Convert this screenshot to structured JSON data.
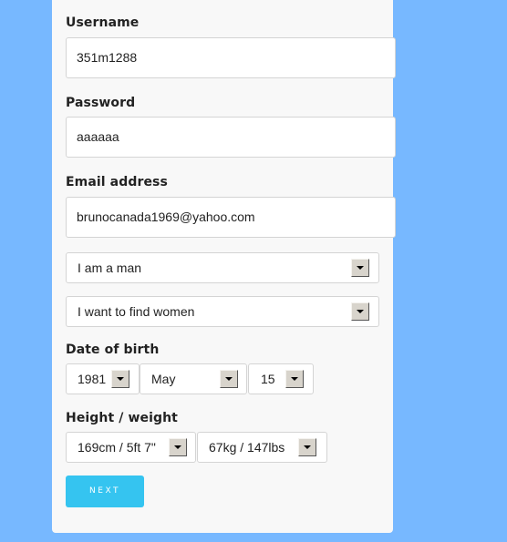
{
  "form": {
    "username": {
      "label": "Username",
      "value": "351m1288"
    },
    "password": {
      "label": "Password",
      "value": "aaaaaa"
    },
    "email": {
      "label": "Email address",
      "value": "brunocanada1969@yahoo.com"
    },
    "gender": {
      "value": "I am a man"
    },
    "seeking": {
      "value": "I want to find women"
    },
    "dob": {
      "label": "Date of birth",
      "year": "1981",
      "month": "May",
      "day": "15"
    },
    "body": {
      "label": "Height / weight",
      "height": "169cm / 5ft 7\"",
      "weight": "67kg / 147lbs"
    },
    "next_label": "NEXT"
  },
  "colors": {
    "background": "#77b8ff",
    "accent": "#35c4f0"
  }
}
